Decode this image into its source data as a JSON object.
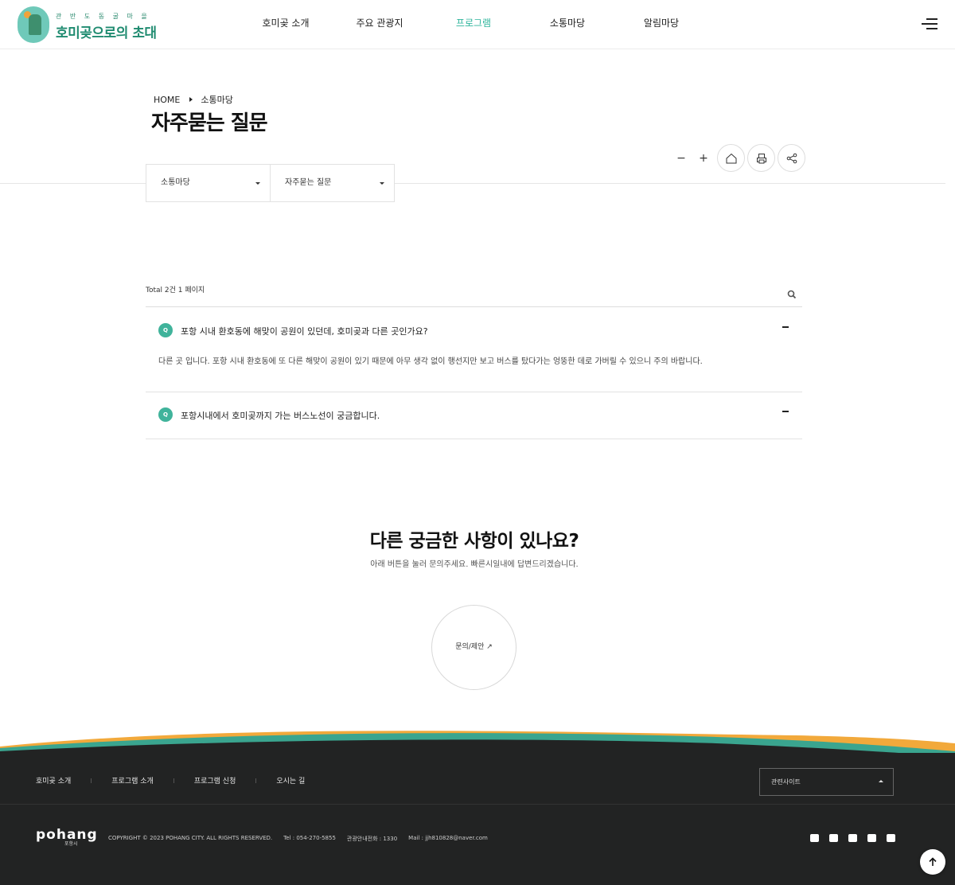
{
  "header": {
    "logo_sub": "관 반 도 동 굴 마 을",
    "logo_title": "호미곶으로의 초대",
    "nav": [
      "호미곶 소개",
      "주요 관광지",
      "프로그램",
      "소통마당",
      "알림마당"
    ],
    "active_nav": "프로그램",
    "accent_color": "#2fb59c"
  },
  "breadcrumb": {
    "home": "HOME",
    "current": "소통마당"
  },
  "page_title": "자주묻는 질문",
  "tools": {
    "zoom_out": "−",
    "zoom_in": "+",
    "icons": [
      "home-icon",
      "print-icon",
      "share-icon"
    ]
  },
  "selects": {
    "depth1": "소통마당",
    "depth2": "자주묻는 질문"
  },
  "list": {
    "total": "Total 2건 1 페이지",
    "items": [
      {
        "badge": "Q",
        "question": "포항 시내 환호동에 해맞이 공원이 있던데, 호미곶과 다른 곳인가요?",
        "answer": "다른 곳 입니다. 포항 시내 환호동에 또 다른 해맞이 공원이 있기 때문에 아무 생각 없이 행선지만 보고 버스를 탔다가는 엉뚱한 데로 가버릴 수 있으니 주의 바랍니다."
      },
      {
        "badge": "Q",
        "question": "포항시내에서 호미곶까지 가는 버스노선이 궁금합니다.",
        "answer": ""
      }
    ]
  },
  "cta": {
    "title": "다른 궁금한 사항이 있나요?",
    "subtitle": "아래 버튼을 눌러 문의주세요. 빠른시일내에 답변드리겠습니다.",
    "button": "문의/제안 ↗"
  },
  "footer": {
    "nav": [
      "호미곶 소개",
      "프로그램 소개",
      "프로그램 신청",
      "오시는 길"
    ],
    "related": "관련사이트",
    "logo": "pohang",
    "logo_sub": "포항시",
    "copyright": "COPYRIGHT © 2023 POHANG CITY. ALL RIGHTS RESERVED.",
    "tel": "Tel : 054-270-5855",
    "tour_tel": "관광안내전화 : 1330",
    "mail": "Mail : jjh810828@naver.com",
    "sns": [
      "youtube-icon",
      "blog-icon",
      "facebook-icon",
      "instagram-icon",
      "kakao-icon"
    ],
    "wave_colors": [
      "#f2a93b",
      "#3aa58f"
    ]
  }
}
